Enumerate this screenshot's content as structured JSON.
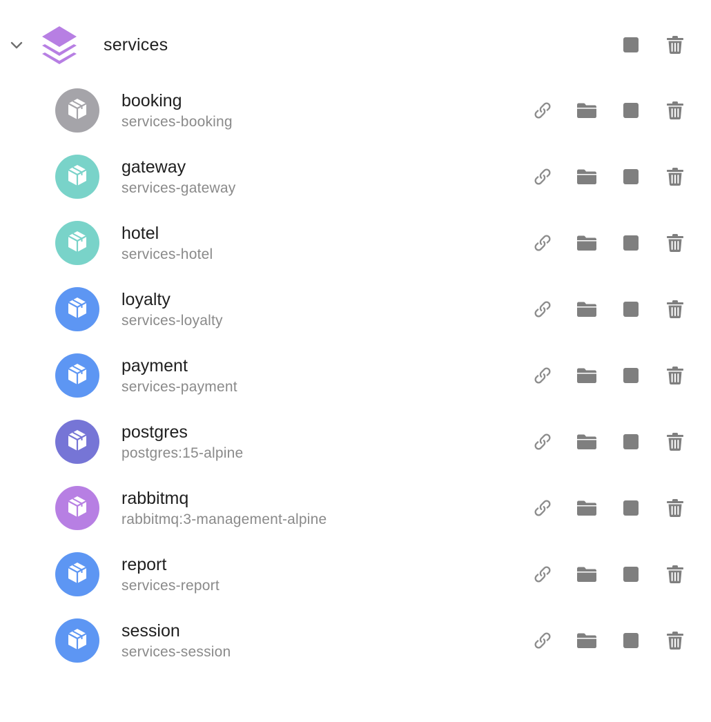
{
  "group": {
    "name": "services",
    "icon": "stack-layers-icon",
    "expanded": true,
    "accent": "#b77fe3"
  },
  "icons": {
    "link": "link-icon",
    "folder": "folder-icon",
    "stop": "stop-icon",
    "trash": "trash-icon",
    "container": "cube-icon",
    "chevron": "chevron-down-icon"
  },
  "colors": {
    "action_icon": "#7f7f7f",
    "link_icon": "#8c8c8c"
  },
  "containers": [
    {
      "name": "booking",
      "image": "services-booking",
      "color": "#a5a4a9"
    },
    {
      "name": "gateway",
      "image": "services-gateway",
      "color": "#79d3c9"
    },
    {
      "name": "hotel",
      "image": "services-hotel",
      "color": "#79d3c9"
    },
    {
      "name": "loyalty",
      "image": "services-loyalty",
      "color": "#5d96f3"
    },
    {
      "name": "payment",
      "image": "services-payment",
      "color": "#5d96f3"
    },
    {
      "name": "postgres",
      "image": "postgres:15-alpine",
      "color": "#7675d6"
    },
    {
      "name": "rabbitmq",
      "image": "rabbitmq:3-management-alpine",
      "color": "#b77fe3"
    },
    {
      "name": "report",
      "image": "services-report",
      "color": "#5d96f3"
    },
    {
      "name": "session",
      "image": "services-session",
      "color": "#5d96f3"
    }
  ]
}
